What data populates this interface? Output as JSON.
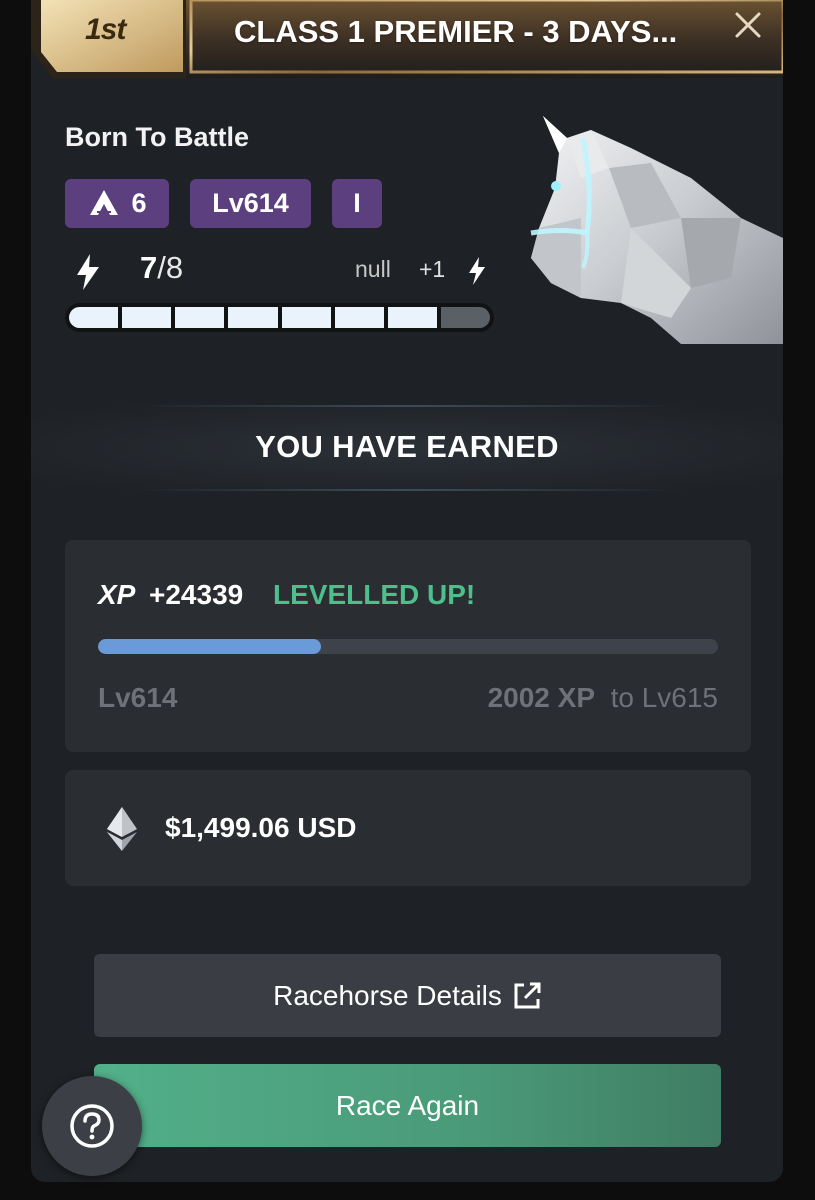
{
  "header": {
    "place": "1st",
    "title": "CLASS 1 PREMIER - 3 DAYS...",
    "close_icon": "close-icon"
  },
  "horse": {
    "name": "Born To Battle",
    "class_badge": "6",
    "level_badge": "Lv614",
    "tier_badge": "I",
    "energy_current": "7",
    "energy_max": "/8",
    "energy_note": "null",
    "energy_regen": "+1",
    "energy_filled_segments": 7,
    "energy_total_segments": 8
  },
  "earned": {
    "title": "YOU HAVE EARNED"
  },
  "xp": {
    "label": "XP",
    "value": "+24339",
    "status": "LEVELLED UP!",
    "progress": 0.36,
    "current_level": "Lv614",
    "needed": "2002 XP",
    "to_level": "to Lv615"
  },
  "reward": {
    "amount": "$1,499.06 USD",
    "icon": "ethereum-icon"
  },
  "buttons": {
    "details": "Racehorse Details",
    "race_again": "Race Again"
  },
  "colors": {
    "panel": "#1e2125",
    "badge": "#5b3f7e",
    "levelled": "#4cbf8a",
    "xp_fill": "#6b9ad9",
    "race_button": "#52b089",
    "gold": "#c9a56a"
  }
}
